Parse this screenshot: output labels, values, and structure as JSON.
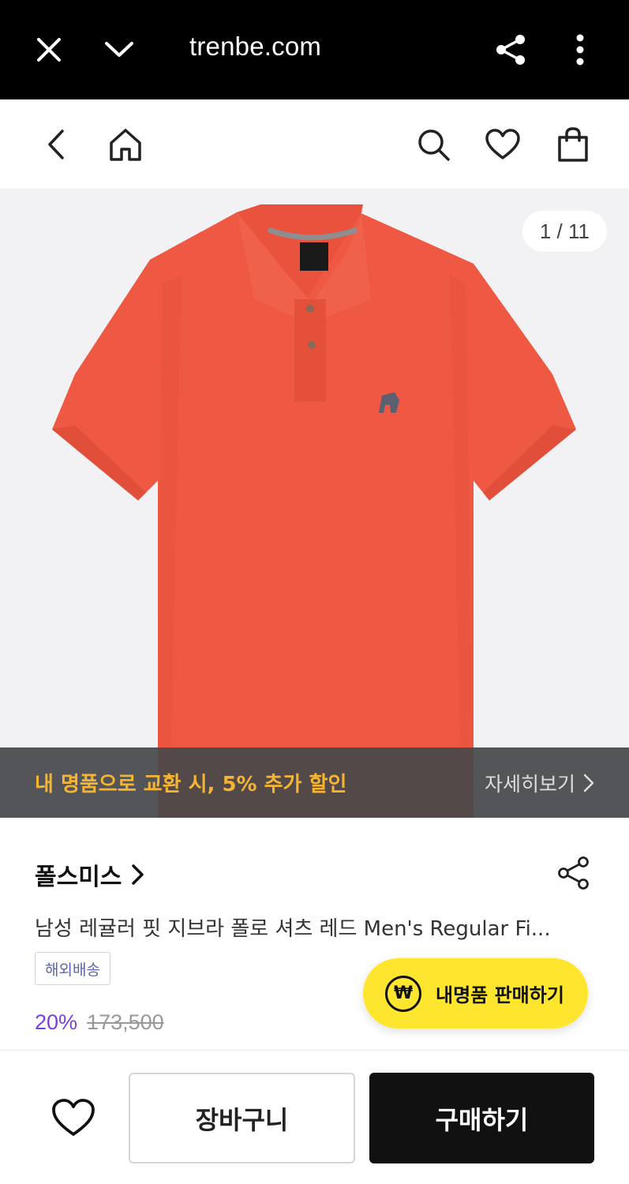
{
  "browser": {
    "url": "trenbe.com",
    "icons": [
      "close-icon",
      "chevron-down-icon",
      "share-icon",
      "more-vertical-icon"
    ]
  },
  "header": {
    "icons": [
      "back-icon",
      "home-icon",
      "search-icon",
      "heart-icon",
      "shopping-bag-icon"
    ]
  },
  "gallery": {
    "counter": "1 / 11"
  },
  "promo": {
    "text": "내 명품으로 교환 시, 5% 추가 할인",
    "more_label": "자세히보기",
    "text_color": "#f5b533"
  },
  "product": {
    "brand": "폴스미스",
    "title": "남성 레귤러 핏 지브라 폴로 셔츠 레드 Men's Regular Fi...",
    "shipping_badge": "해외배송",
    "discount": "20%",
    "original_price": "173,500",
    "discount_color": "#7a3fe0"
  },
  "sell_button": {
    "label": "내명품 판매하기",
    "icon_glyph": "₩",
    "color": "#ffe62e"
  },
  "bottom_bar": {
    "cart_label": "장바구니",
    "buy_label": "구매하기"
  }
}
